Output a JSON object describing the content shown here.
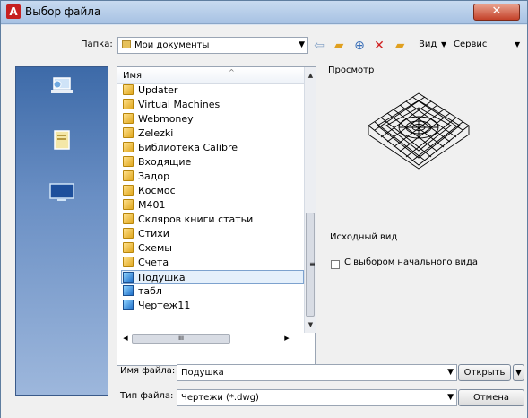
{
  "window": {
    "title": "Выбор файла",
    "app_icon": "A"
  },
  "toolbar": {
    "folder_label": "Папка:",
    "folder_value": "Мои документы",
    "view_label": "Вид",
    "service_label": "Сервис"
  },
  "file_list": {
    "column_name": "Имя",
    "items": [
      {
        "name": "Updater",
        "type": "folder"
      },
      {
        "name": "Virtual Machines",
        "type": "folder"
      },
      {
        "name": "Webmoney",
        "type": "folder"
      },
      {
        "name": "Zelezki",
        "type": "folder"
      },
      {
        "name": "Библиотека Calibre",
        "type": "folder"
      },
      {
        "name": "Входящие",
        "type": "folder"
      },
      {
        "name": "Задор",
        "type": "folder"
      },
      {
        "name": "Космос",
        "type": "folder"
      },
      {
        "name": "M401",
        "type": "folder"
      },
      {
        "name": "Скляров книги статьи",
        "type": "folder"
      },
      {
        "name": "Стихи",
        "type": "folder"
      },
      {
        "name": "Схемы",
        "type": "folder"
      },
      {
        "name": "Счета",
        "type": "folder"
      },
      {
        "name": "Подушка",
        "type": "drawing",
        "selected": true
      },
      {
        "name": "табл",
        "type": "drawing"
      },
      {
        "name": "Чертеж11",
        "type": "drawing"
      }
    ]
  },
  "preview": {
    "label": "Просмотр",
    "initial_view_label": "Исходный вид",
    "checkbox_label": "С выбором начального вида"
  },
  "bottom": {
    "filename_label": "Имя файла:",
    "filename_value": "Подушка",
    "filetype_label": "Тип файла:",
    "filetype_value": "Чертежи (*.dwg)",
    "open_button": "Открыть",
    "cancel_button": "Отмена"
  },
  "colors": {
    "title_accent": "#c62020",
    "places_bar": "#4a73b0",
    "selection": "#e5f0fb"
  }
}
